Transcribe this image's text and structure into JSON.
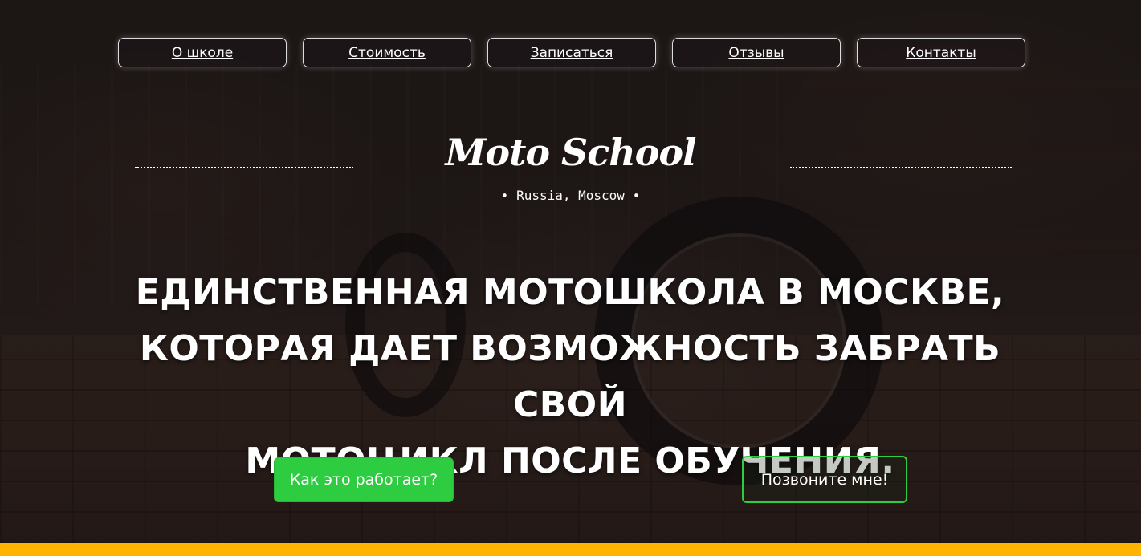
{
  "nav": {
    "items": [
      {
        "label": "О школе"
      },
      {
        "label": "Стоимость"
      },
      {
        "label": "Записаться"
      },
      {
        "label": "Отзывы"
      },
      {
        "label": "Контакты"
      }
    ]
  },
  "logo": {
    "text": "Moto School",
    "location": "Russia, Moscow",
    "bullet": "•"
  },
  "hero": {
    "headline_line1": "ЕДИНСТВЕННАЯ МОТОШКОЛА В МОСКВЕ,",
    "headline_line2": "КОТОРАЯ ДАЕТ ВОЗМОЖНОСТЬ ЗАБРАТЬ СВОЙ",
    "headline_line3": "МОТОЦИКЛ ПОСЛЕ ОБУЧЕНИЯ."
  },
  "buttons": {
    "how_it_works": "Как это работает?",
    "call_me": "Позвоните мне!"
  },
  "colors": {
    "accent_green": "#2ecc40",
    "bottom_bar": "#ffb400"
  }
}
